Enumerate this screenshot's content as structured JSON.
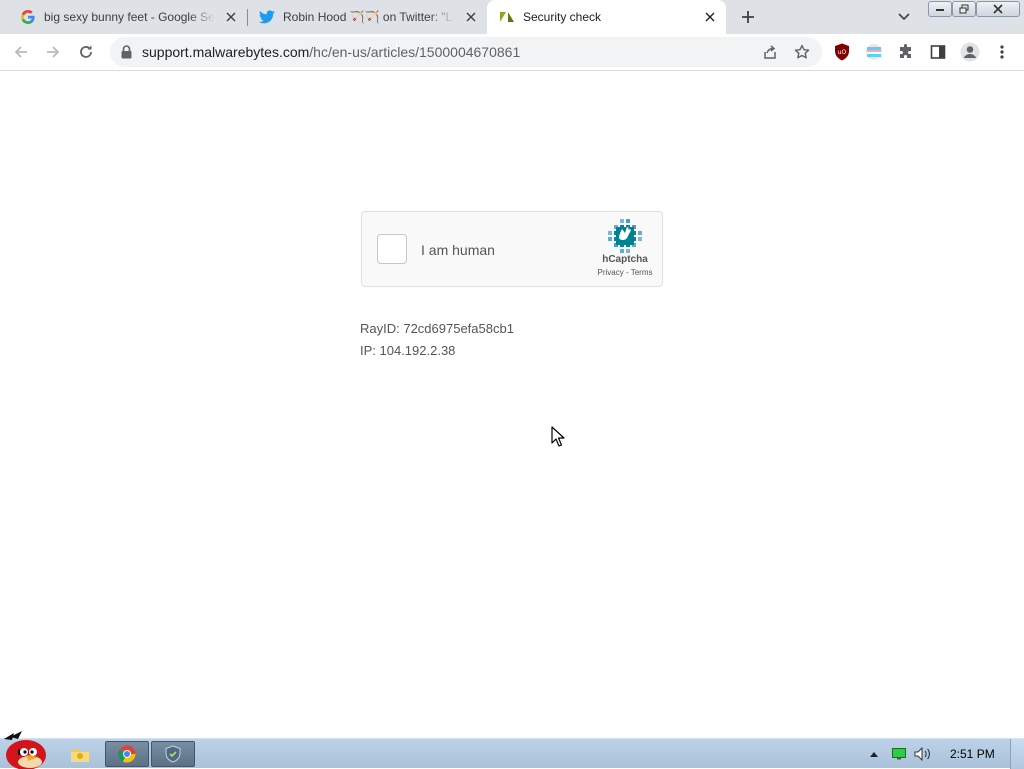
{
  "tabs": [
    {
      "title": "big sexy bunny feet - Google Search",
      "favicon": "google-icon",
      "active": false
    },
    {
      "title": "Robin Hood 🏹🏹 on Twitter: \"Lola",
      "favicon": "twitter-icon",
      "active": false
    },
    {
      "title": "Security check",
      "favicon": "zendesk-icon",
      "active": true
    }
  ],
  "address_bar": {
    "domain": "support.malwarebytes.com",
    "path": "/hc/en-us/articles/1500004670861"
  },
  "captcha": {
    "checkbox_label": "I am human",
    "brand": "hCaptcha",
    "privacy_link": "Privacy",
    "separator": " - ",
    "terms_link": "Terms"
  },
  "info": {
    "ray_id": "RayID: 72cd6975efa58cb1",
    "ip": "IP: 104.192.2.38"
  },
  "taskbar": {
    "clock": "2:51 PM"
  },
  "colors": {
    "tabstrip_bg": "#dee1e6",
    "omnibox_bg": "#f1f3f4",
    "hcaptcha_teal": "#00838f",
    "taskbar_bg": "#b5cbe2"
  }
}
